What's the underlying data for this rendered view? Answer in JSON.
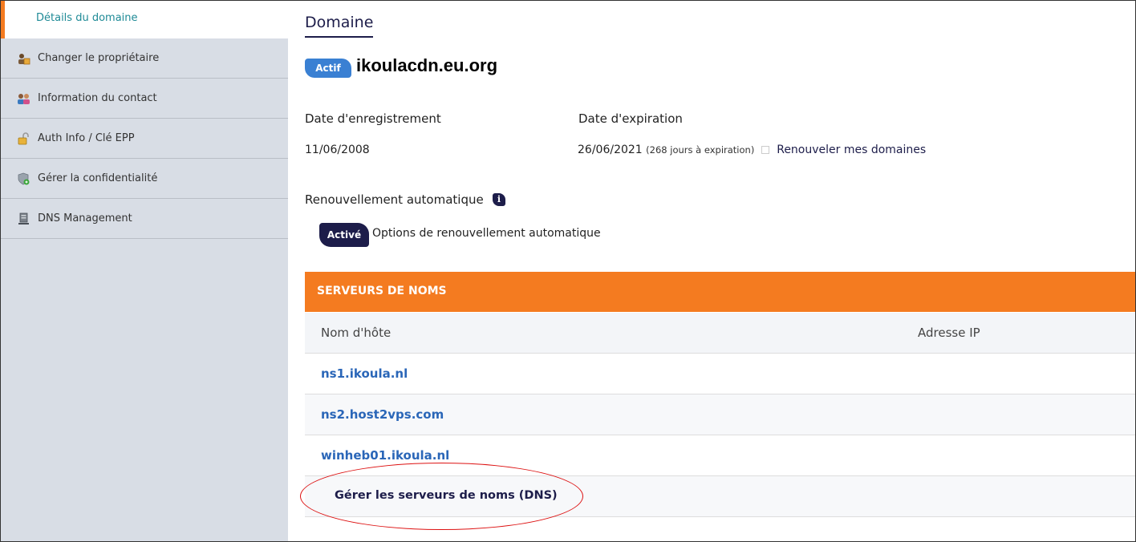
{
  "sidebar": {
    "active_item": "Détails du domaine",
    "items": [
      {
        "label": "Changer le propriétaire",
        "icon": "owner-change-icon"
      },
      {
        "label": "Information du contact",
        "icon": "contact-info-icon"
      },
      {
        "label": "Auth Info / Clé EPP",
        "icon": "lock-icon"
      },
      {
        "label": "Gérer la confidentialité",
        "icon": "shield-icon"
      },
      {
        "label": "DNS Management",
        "icon": "server-icon"
      }
    ]
  },
  "main": {
    "title": "Domaine",
    "status_badge": "Actif",
    "domain_name": "ikoulacdn.eu.org",
    "registration_label": "Date d'enregistrement",
    "registration_date": "11/06/2008",
    "expiration_label": "Date d'expiration",
    "expiration_date": "26/06/2021",
    "expiration_note": "(268 jours à expiration)",
    "renew_link": "Renouveler mes domaines",
    "auto_renew_label": "Renouvellement automatique",
    "info_icon_glyph": "i",
    "auto_renew_badge": "Activé",
    "auto_renew_options": "Options de renouvellement automatique"
  },
  "nameservers": {
    "header": "SERVEURS DE NOMS",
    "columns": [
      "Nom d'hôte",
      "Adresse IP"
    ],
    "rows": [
      {
        "host": "ns1.ikoula.nl",
        "ip": ""
      },
      {
        "host": "ns2.host2vps.com",
        "ip": ""
      },
      {
        "host": "winheb01.ikoula.nl",
        "ip": ""
      }
    ],
    "manage_link": "Gérer les serveurs de noms (DNS)"
  },
  "colors": {
    "accent_orange": "#f47b20",
    "navy": "#1d1d4a",
    "link_blue": "#2a66b8",
    "badge_blue": "#3a80d3",
    "sidebar_bg": "#d8dde5",
    "annotation_red": "#dd1111"
  }
}
